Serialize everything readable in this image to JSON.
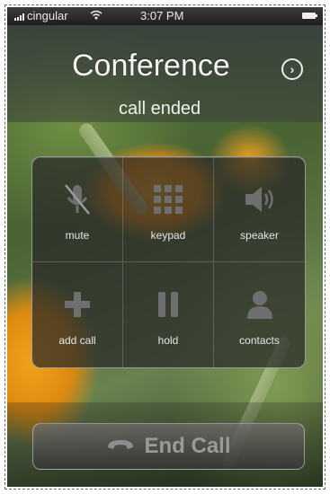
{
  "status_bar": {
    "carrier": "cingular",
    "time": "3:07 PM"
  },
  "header": {
    "title": "Conference",
    "subtitle": "call ended",
    "info_icon": "chevron-right-circle-icon"
  },
  "keypad": {
    "buttons": [
      {
        "label": "mute",
        "icon": "microphone-muted-icon"
      },
      {
        "label": "keypad",
        "icon": "keypad-grid-icon"
      },
      {
        "label": "speaker",
        "icon": "speaker-icon"
      },
      {
        "label": "add call",
        "icon": "plus-icon"
      },
      {
        "label": "hold",
        "icon": "pause-icon"
      },
      {
        "label": "contacts",
        "icon": "person-icon"
      }
    ]
  },
  "end_call": {
    "label": "End Call",
    "icon": "handset-icon"
  },
  "colors": {
    "flower": "#f5a51c",
    "panel": "#282828",
    "text": "#f4f4f4"
  }
}
